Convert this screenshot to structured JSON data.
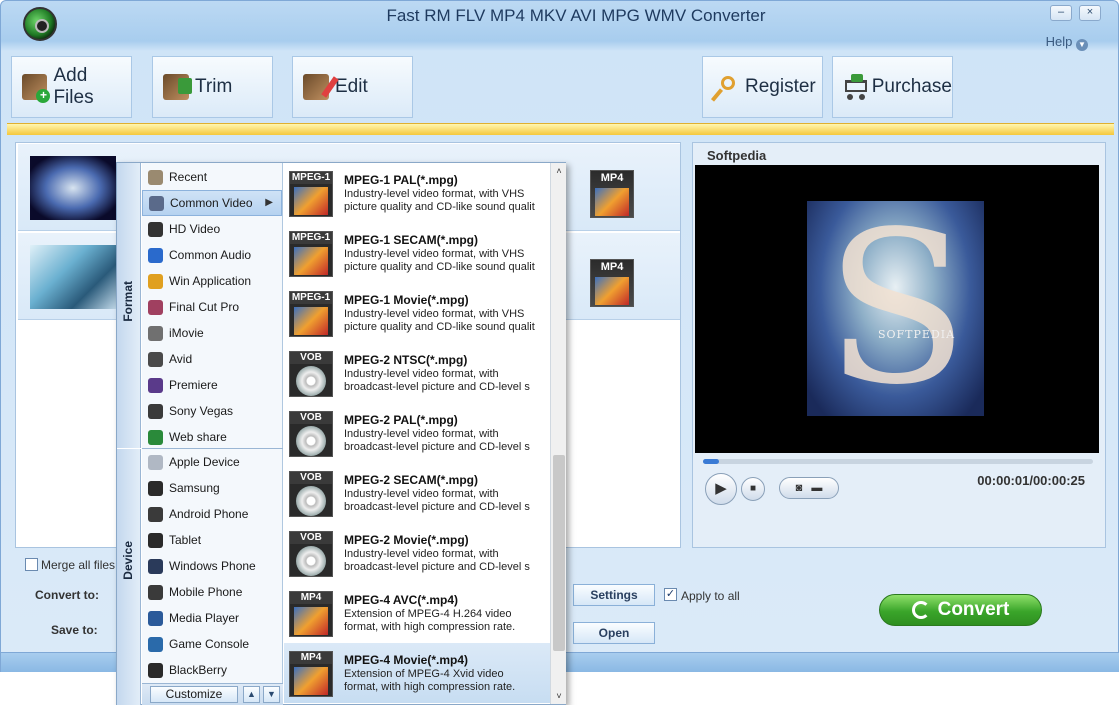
{
  "window": {
    "title": "Fast RM FLV MP4 MKV AVI MPG WMV Converter",
    "minimize": "–",
    "close": "×",
    "help": "Help"
  },
  "toolbar": {
    "add_files": "Add Files",
    "trim": "Trim",
    "edit": "Edit",
    "register": "Register",
    "purchase": "Purchase"
  },
  "files": [
    {
      "format_badge": "MP4"
    },
    {
      "format_badge": "MP4"
    }
  ],
  "preview": {
    "title": "Softpedia",
    "brand_text": "SOFTPEDIA",
    "time": "00:00:01/00:00:25",
    "progress_fraction": 0.04
  },
  "bottom": {
    "merge_label": "Merge all files",
    "convert_to_label": "Convert to:",
    "save_to_label": "Save to:",
    "settings_button": "Settings",
    "open_button": "Open",
    "apply_label": "Apply to all",
    "apply_checked": true,
    "convert_button": "Convert"
  },
  "menu": {
    "format_tab": "Format",
    "device_tab": "Device",
    "customize": "Customize",
    "categories": [
      {
        "label": "Recent",
        "icon": "recent-icon",
        "color": "#9a8a70"
      },
      {
        "label": "Common Video",
        "icon": "film-icon",
        "color": "#5a6a8a",
        "selected": true
      },
      {
        "label": "HD Video",
        "icon": "hd-icon",
        "color": "#333333"
      },
      {
        "label": "Common Audio",
        "icon": "music-note-icon",
        "color": "#2a6acc"
      },
      {
        "label": "Win Application",
        "icon": "windows-icon",
        "color": "#e0a020"
      },
      {
        "label": "Final Cut Pro",
        "icon": "final-cut-icon",
        "color": "#a04060"
      },
      {
        "label": "iMovie",
        "icon": "star-icon",
        "color": "#707070"
      },
      {
        "label": "Avid",
        "icon": "avid-icon",
        "color": "#4a4a4a"
      },
      {
        "label": "Premiere",
        "icon": "premiere-icon",
        "color": "#5a3a8a"
      },
      {
        "label": "Sony Vegas",
        "icon": "vegas-icon",
        "color": "#3a3a3a"
      },
      {
        "label": "Web share",
        "icon": "globe-icon",
        "color": "#2a8a3a"
      },
      {
        "label": "Apple Device",
        "icon": "apple-device-icon",
        "color": "#b0b8c4"
      },
      {
        "label": "Samsung",
        "icon": "phone-icon",
        "color": "#2a2a2a"
      },
      {
        "label": "Android Phone",
        "icon": "android-phone-icon",
        "color": "#3a3a3a"
      },
      {
        "label": "Tablet",
        "icon": "tablet-icon",
        "color": "#2a2a2a"
      },
      {
        "label": "Windows Phone",
        "icon": "windows-phone-icon",
        "color": "#2a3a5a"
      },
      {
        "label": "Mobile Phone",
        "icon": "mobile-phone-icon",
        "color": "#3a3a3a"
      },
      {
        "label": "Media Player",
        "icon": "media-player-icon",
        "color": "#2a5a9a"
      },
      {
        "label": "Game Console",
        "icon": "game-console-icon",
        "color": "#2a6aaa"
      },
      {
        "label": "BlackBerry",
        "icon": "blackberry-icon",
        "color": "#2a2a2a"
      }
    ],
    "formats": [
      {
        "badge": "MPEG-1",
        "icon": "mpeg-icon",
        "name": "MPEG-1 PAL(*.mpg)",
        "desc": "Industry-level video format, with VHS\npicture quality and CD-like sound qualit"
      },
      {
        "badge": "MPEG-1",
        "icon": "mpeg-icon",
        "name": "MPEG-1 SECAM(*.mpg)",
        "desc": "Industry-level video format, with VHS\npicture quality and CD-like sound qualit"
      },
      {
        "badge": "MPEG-1",
        "icon": "mpeg-icon",
        "name": "MPEG-1 Movie(*.mpg)",
        "desc": "Industry-level video format, with VHS\npicture quality and CD-like sound qualit"
      },
      {
        "badge": "VOB",
        "icon": "disc-icon",
        "name": "MPEG-2 NTSC(*.mpg)",
        "desc": "Industry-level video format, with\nbroadcast-level picture and CD-level s"
      },
      {
        "badge": "VOB",
        "icon": "disc-icon",
        "name": "MPEG-2 PAL(*.mpg)",
        "desc": "Industry-level video format, with\nbroadcast-level picture and CD-level s"
      },
      {
        "badge": "VOB",
        "icon": "disc-icon",
        "name": "MPEG-2 SECAM(*.mpg)",
        "desc": "Industry-level video format, with\nbroadcast-level picture and CD-level s"
      },
      {
        "badge": "VOB",
        "icon": "disc-icon",
        "name": "MPEG-2 Movie(*.mpg)",
        "desc": "Industry-level video format, with\nbroadcast-level picture and CD-level s"
      },
      {
        "badge": "MP4",
        "icon": "mp4-icon",
        "name": "MPEG-4 AVC(*.mp4)",
        "desc": "Extension of MPEG-4 H.264 video\nformat, with high compression rate."
      },
      {
        "badge": "MP4",
        "icon": "mp4-icon",
        "name": "MPEG-4 Movie(*.mp4)",
        "desc": "Extension of MPEG-4 Xvid video\nformat, with high compression rate.",
        "selected": true
      }
    ]
  }
}
